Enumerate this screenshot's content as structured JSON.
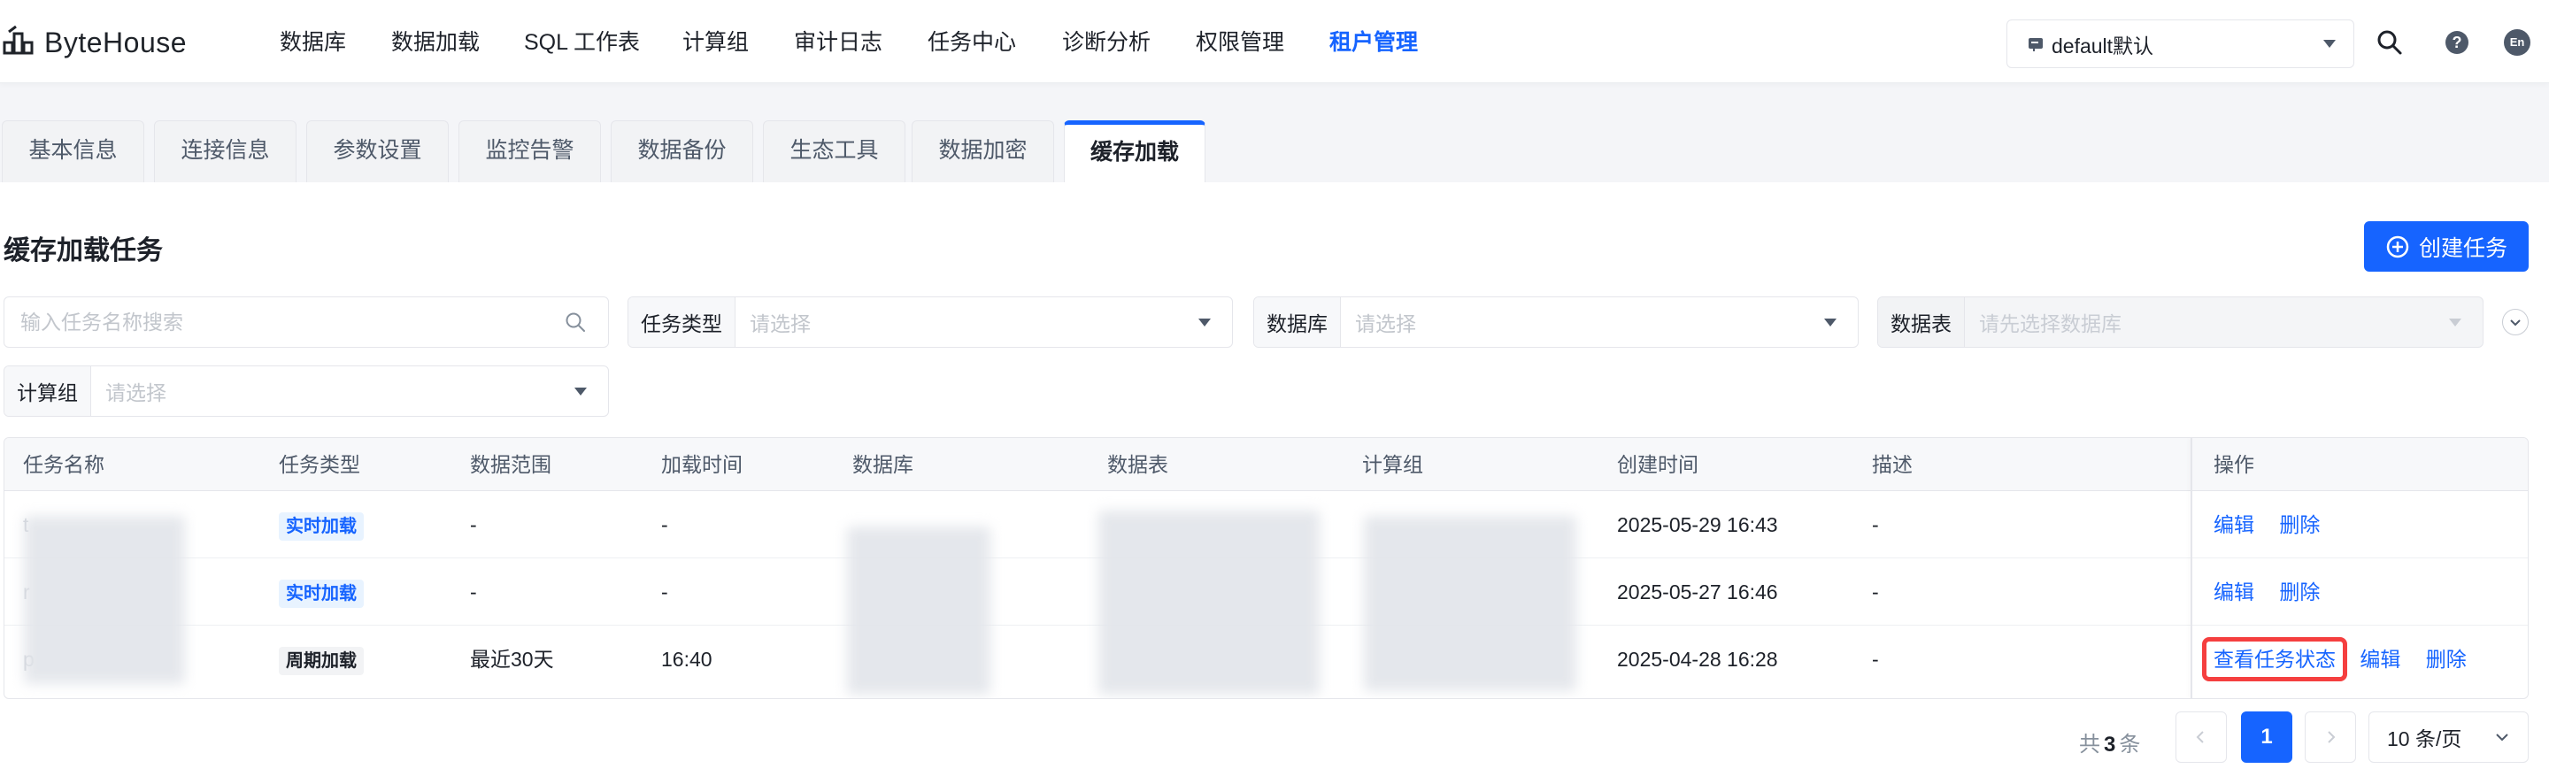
{
  "brand": {
    "name": "ByteHouse"
  },
  "nav": {
    "items": [
      "数据库",
      "数据加载",
      "SQL 工作表",
      "计算组",
      "审计日志",
      "任务中心",
      "诊断分析",
      "权限管理",
      "租户管理"
    ],
    "active_index": 8
  },
  "tenant": {
    "value": "default默认"
  },
  "lang": {
    "label": "En"
  },
  "tabs": [
    "基本信息",
    "连接信息",
    "参数设置",
    "监控告警",
    "数据备份",
    "生态工具",
    "数据加密",
    "缓存加载"
  ],
  "active_tab": 7,
  "page": {
    "title": "缓存加载任务",
    "create_label": "创建任务"
  },
  "filters": {
    "search_placeholder": "输入任务名称搜索",
    "task_type": {
      "label": "任务类型",
      "placeholder": "请选择"
    },
    "database": {
      "label": "数据库",
      "placeholder": "请选择"
    },
    "table": {
      "label": "数据表",
      "placeholder": "请先选择数据库"
    },
    "compute_group": {
      "label": "计算组",
      "placeholder": "请选择"
    }
  },
  "table": {
    "columns": [
      "任务名称",
      "任务类型",
      "数据范围",
      "加载时间",
      "数据库",
      "数据表",
      "计算组",
      "创建时间",
      "描述",
      "操作"
    ],
    "rows": [
      {
        "name_initial": "t",
        "type": "实时加载",
        "type_kind": "realtime",
        "range": "-",
        "load_time": "-",
        "created": "2025-05-29 16:43",
        "desc": "-",
        "actions": [
          "编辑",
          "删除"
        ]
      },
      {
        "name_initial": "r",
        "type": "实时加载",
        "type_kind": "realtime",
        "range": "-",
        "load_time": "-",
        "created": "2025-05-27 16:46",
        "desc": "-",
        "actions": [
          "编辑",
          "删除"
        ]
      },
      {
        "name_initial": "p",
        "type": "周期加载",
        "type_kind": "periodic",
        "range": "最近30天",
        "load_time": "16:40",
        "created": "2025-04-28 16:28",
        "desc": "-",
        "actions": [
          "查看任务状态",
          "编辑",
          "删除"
        ]
      }
    ]
  },
  "pagination": {
    "total_prefix": "共",
    "total": "3",
    "total_suffix": "条",
    "current_page": "1",
    "page_size": "10 条/页"
  },
  "colors": {
    "primary": "#1664ff",
    "highlight": "#f53f3f"
  }
}
